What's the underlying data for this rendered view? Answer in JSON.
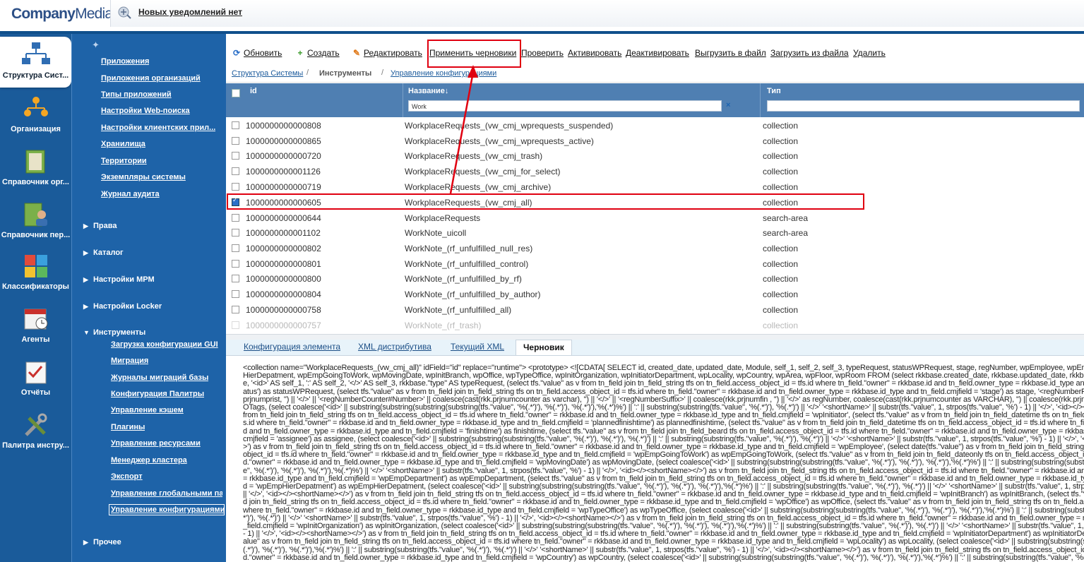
{
  "header": {
    "logo_company": "Company",
    "logo_media": "Media",
    "notification": "Новых уведомлений нет"
  },
  "leftnav": [
    {
      "label": "Структура Сист...",
      "icon": "structure-icon",
      "active": true
    },
    {
      "label": "Организация",
      "icon": "org-chart-icon"
    },
    {
      "label": "Справочник орг...",
      "icon": "folder-icon"
    },
    {
      "label": "Справочник пер...",
      "icon": "people-folder-icon"
    },
    {
      "label": "Классификаторы",
      "icon": "puzzle-icon"
    },
    {
      "label": "Агенты",
      "icon": "calendar-icon"
    },
    {
      "label": "Отчёты",
      "icon": "report-icon"
    },
    {
      "label": "Палитра инстру...",
      "icon": "tools-icon"
    }
  ],
  "tree": {
    "links": [
      "Приложения",
      "Приложения организаций",
      "Типы приложений",
      "Настройки Web-поиска",
      "Настройки клиентских прил...",
      "Хранилища",
      "Территории",
      "Экземпляры системы",
      "Журнал аудита"
    ],
    "groups": [
      "Права",
      "Каталог",
      "Настройки МРМ",
      "Настройки Locker"
    ],
    "tools_group": "Инструменты",
    "tools_items": [
      "Загрузка конфигурации GUI",
      "Миграция",
      "Журналы миграций базы",
      "Конфигурация Палитры",
      "Управление кэшем",
      "Плагины",
      "Управление ресурсами",
      "Менеджер кластера",
      "Экспорт",
      "Управление глобальными па",
      "Управление конфигурациями"
    ],
    "other_group": "Прочее"
  },
  "toolbar": {
    "refresh": "Обновить",
    "create": "Создать",
    "edit": "Редактировать",
    "apply_drafts": "Применить черновики",
    "check": "Проверить",
    "activate": "Активировать",
    "deactivate": "Деактивировать",
    "export": "Выгрузить в файл",
    "import": "Загрузить из файла",
    "delete": "Удалить"
  },
  "breadcrumb": {
    "root": "Структура Системы",
    "middle": "Инструменты",
    "current": "Управление конфигурациями"
  },
  "grid": {
    "col_id": "id",
    "col_name": "Название↓",
    "col_type": "Тип",
    "filter_name": "Work",
    "filter_type": "",
    "rows": [
      {
        "id": "1000000000000808",
        "name": "WorkplaceRequests_(vw_cmj_wprequests_suspended)",
        "type": "collection",
        "checked": false
      },
      {
        "id": "1000000000000865",
        "name": "WorkplaceRequests_(vw_cmj_wprequests_active)",
        "type": "collection",
        "checked": false
      },
      {
        "id": "1000000000000720",
        "name": "WorkplaceRequests_(vw_cmj_trash)",
        "type": "collection",
        "checked": false
      },
      {
        "id": "1000000000001126",
        "name": "WorkplaceRequests_(vw_cmj_for_select)",
        "type": "collection",
        "checked": false
      },
      {
        "id": "1000000000000719",
        "name": "WorkplaceRequests_(vw_cmj_archive)",
        "type": "collection",
        "checked": false
      },
      {
        "id": "1000000000000605",
        "name": "WorkplaceRequests_(vw_cmj_all)",
        "type": "collection",
        "checked": true
      },
      {
        "id": "1000000000000644",
        "name": "WorkplaceRequests",
        "type": "search-area",
        "checked": false
      },
      {
        "id": "1000000000001102",
        "name": "WorkNote_uicoll",
        "type": "search-area",
        "checked": false
      },
      {
        "id": "1000000000000802",
        "name": "WorkNote_(rf_unfulfilled_null_res)",
        "type": "collection",
        "checked": false
      },
      {
        "id": "1000000000000801",
        "name": "WorkNote_(rf_unfulfilled_control)",
        "type": "collection",
        "checked": false
      },
      {
        "id": "1000000000000800",
        "name": "WorkNote_(rf_unfulfilled_by_rf)",
        "type": "collection",
        "checked": false
      },
      {
        "id": "1000000000000804",
        "name": "WorkNote_(rf_unfulfilled_by_author)",
        "type": "collection",
        "checked": false
      },
      {
        "id": "1000000000000758",
        "name": "WorkNote_(rf_unfulfilled_all)",
        "type": "collection",
        "checked": false
      },
      {
        "id": "1000000000000757",
        "name": "WorkNote_(rf_trash)",
        "type": "collection",
        "checked": false
      }
    ]
  },
  "tabs": [
    "Конфигурация элемента",
    "XML дистрибутива",
    "Текущий XML",
    "Черновик"
  ],
  "active_tab": "Черновик",
  "xml_content": "<collection name=\"WorkplaceRequests_(vw_cmj_all)\" idField=\"id\" replace=\"runtime\"> <prototype> <![CDATA[ SELECT id, created_date, updated_date, Module, self_1, self_2, self_3, typeRequest, statusWPRequest, stage, regNumber, wpEmployee, wpEmpDepartment, wpEmpHierDepatment, wpEmpGoingToWork, wpMovingDate, wpInitBranch, wpOffice, wpTypeOffice, wpInitOrganization, wpInitiatorDepartment, wpLocality, wpCountry, wpArea, wpFloor, wpRoom FROM (select rkkbase.created_date, rkkbase.updated_date, rkkbase.module AS Module, '<id>' AS self_1, ':' AS self_2, '</>' AS self_3, rkkbase.\"type\" AS typeRequest, (select tfs.\"value\" as v from tn_field join tn_field_string tfs on tn_field.access_object_id = tfs.id where tn_field.\"owner\" = rkkbase.id and tn_field.owner_type = rkkbase.id_type and tn_field.cmjfield = 'status') as statusWPRequest, (select tfs.\"value\" as v from tn_field join tn_field_string tfs on tn_field.access_object_id = tfs.id where tn_field.\"owner\" = rkkbase.id and tn_field.owner_type = rkkbase.id_type and tn_field.cmjfield = 'stage') as stage, '<regNumberPrefix>' || coalesce(rkk.prjnumprist, '') || '</>' || '<regNumberCounter#Number>' || coalesce(cast(rkk.prjnumcounter as varchar), '') || '</>' || '<regNumberSuffix>' || coalesce(rkk.prjnumfin , '') || '</>' as regNumber, coalesce(cast(rkk.prjnumcounter as VARCHAR), '') || coalesce(rkk.prjnumfin, '') as numberWOTags, (select coalesce('<id>' || substring(substring(substring(substring(tfs.\"value\", '%(.*')'), '%(.*')'), '%(.*')'),'%(.*')%') || ':' || substring(substring(tfs.\"value\", '%(.*')'), '%(.*')') || '</>' '<shortName>' || substr(tfs.\"value\", 1, strpos(tfs.\"value\", '%') - 1) || '</>', '<id></><shortName></>') as v from tn_field join tn_field_string tfs on tn_field.access_object_id = tfs.id where tn_field.\"owner\" = rkkbase.id and tn_field.owner_type = rkkbase.id_type and tn_field.cmjfield = 'wpInitiator', (select tfs.\"value\" as v from tn_field join tn_field_datetime tfs on tn_field.access_object_id = tfs.id where tn_field.\"owner\" = rkkbase.id and tn_field.owner_type = rkkbase.id_type and tn_field.cmjfield = 'plannedfinishtime') as plannedfinishtime, (select tfs.\"value\" as v from tn_field join tn_field_datetime tfs on tn_field.access_object_id = tfs.id where tn_field.\"owner\" = rkkbase.id and tn_field.owner_type = rkkbase.id_type and tn_field.cmjfield = 'finishtime') as finishtime, (select tfs.\"value\" as v from tn_field join tn_field_beard tfs on tn_field.access_object_id = tfs.id where tn_field.\"owner\" = rkkbase.id and tn_field.owner_type = rkkbase.id_type and tn_field.cmjfield = 'assignee') as assignee, (select coalesce('<id>' || substring(substring(substring(tfs.\"value\", '%(.*')'), '%(.*')'), '%(.*')') || ':' || substring(substring(tfs.\"value\", '%(.*')'), '%(.*')') || '</>' '<shortName>' || substr(tfs.\"value\", 1, strpos(tfs.\"value\", '%') - 1) || '</>', '<id></><shortName></>') as v from tn_field join tn_field_string tfs on tn_field.access_object_id = tfs.id where tn_field.\"owner\" = rkkbase.id and tn_field.owner_type = rkkbase.id_type and tn_field.cmjfield = 'wpEmployee', (select date(tfs.\"value\") as v from tn_field join tn_field_string tfs on tn_field.access_object_id = tfs.id where tn_field.\"owner\" = rkkbase.id and tn_field.owner_type = rkkbase.id_type and tn_field.cmjfield = 'wpEmpGoingToWork') as wpEmpGoingToWork, (select tfs.\"value\" as v from tn_field join tn_field_dateonly tfs on tn_field.access_object_id = tfs.id where tn_field.\"owner\" = rkkbase.id and tn_field.owner_type = rkkbase.id_type and tn_field.cmjfield = 'wpMovingDate') as wpMovingDate, (select coalesce('<id>' || substring(substring(substring(tfs.\"value\", '%(.*')'), '%(.*')'), '%(.*')'),'%(.*')%') || ':' || substring(substring(substring(substring(tfs.\"value\", '%(.*')'), '%(.*')'), '%(.*')'),'%(.*')%') || '</>' '<shortName>' || substr(tfs.\"value\", 1, strpos(tfs.\"value\", '%') - 1) || '</>', '<id></><shortName></>') as v from tn_field join tn_field_string tfs on tn_field.access_object_id = tfs.id where tn_field.\"owner\" = rkkbase.id and tn_field.owner_type = rkkbase.id_type and tn_field.cmjfield = 'wpEmpDepartment') as wpEmpDepartment, (select tfs.\"value\" as v from tn_field join tn_field_string tfs on tn_field.access_object_id = tfs.id where tn_field.\"owner\" = rkkbase.id and tn_field.owner_type = rkkbase.id_type and tn_field.cmjfield = 'wpEmpHierDepatment') as wpEmpHierDepatment, (select coalesce('<id>' || substring(substring(substring(tfs.\"value\", '%(.*')'), '%(.*')'), '%(.*')'),'%(.*')%') || ':' || substring(substring(tfs.\"value\", '%(.*')'), '%(.*')') || '</>' '<shortName>' || substr(tfs.\"value\", 1, strpos(tfs.\"value\", '%') - 1) || '</>', '<id></><shortName></>') as v from tn_field join tn_field_string tfs on tn_field.access_object_id = tfs.id where tn_field.\"owner\" = rkkbase.id and tn_field.owner_type = rkkbase.id_type and tn_field.cmjfield = 'wpInitBranch') as wpInitBranch, (select tfs.\"value\" as v from tn_field join tn_field_string tfs on tn_field.access_object_id = tfs.id where tn_field.\"owner\" = rkkbase.id and tn_field.owner_type = rkkbase.id_type and tn_field.cmjfield = 'wpOffice') as wpOffice, (select tfs.\"value\" as v from tn_field join tn_field_string tfs on tn_field.access_object_id = tfs.id where tn_field.\"owner\" = rkkbase.id and tn_field.owner_type = rkkbase.id_type and tn_field.cmjfield = 'wpTypeOffice') as wpTypeOffice, (select coalesce('<id>' || substring(substring(substring(tfs.\"value\", '%(.*')'), '%(.*')'), '%(.*')'),'%(.*')%') || ':' || substring(substring(tfs.\"value\", '%(.*')'), '%(.*')') || '</>' '<shortName>' || substr(tfs.\"value\", 1, strpos(tfs.\"value\", '%') - 1) || '</>', '<id></><shortName></>') as v from tn_field join tn_field_string tfs on tn_field.access_object_id = tfs.id where tn_field.\"owner\" = rkkbase.id and tn_field.owner_type = rkkbase.id_type and tn_field.cmjfield = 'wpInitOrganization') as wpInitOrganization, (select coalesce('<id>' || substring(substring(substring(tfs.\"value\", '%(.*')'), '%(.*')'), '%(.*')'),'%(.*')%') || ':' || substring(substring(tfs.\"value\", '%(.*')'), '%(.*')') || '</>' '<shortName>' || substr(tfs.\"value\", 1, strpos(tfs.\"value\", '%') - 1) || '</>', '<id></><shortName></>') as v from tn_field join tn_field_string tfs on tn_field.access_object_id = tfs.id where tn_field.\"owner\" = rkkbase.id and tn_field.owner_type = rkkbase.id_type and tn_field.cmjfield = 'wpInitiatorDepartment') as wpInitiatorDepartment, (select tfs.\"value\" as v from tn_field join tn_field_string tfs on tn_field.access_object_id = tfs.id where tn_field.\"owner\" = rkkbase.id and tn_field.owner_type = rkkbase.id_type and tn_field.cmjfield = 'wpLocality') as wpLocality, (select coalesce('<id>' || substring(substring(substring(tfs.\"value\", '%(.*')'), '%(.*')'), '%(.*')'),'%(.*')%') || ':' || substring(substring(tfs.\"value\", '%(.*')'), '%(.*')') || '</>' '<shortName>' || substr(tfs.\"value\", 1, strpos(tfs.\"value\", '%') - 1) || '</>', '<id></><shortName></>') as v from tn_field join tn_field_string tfs on tn_field.access_object_id = tfs.id where tn_field.\"owner\" = rkkbase.id and tn_field.owner_type = rkkbase.id_type and tn_field.cmjfield = 'wpCountry') as wpCountry, (select coalesce('<id>' || substring(substring(substring(tfs.\"value\", '%(.*')'), '%(.*')'), '%(.*')'),'%(.*')%') || ':' || substring(substring(tfs.\"value\", '%(.*')'), '%(.*')') || '</>' '<shortName>' || substr(tfs.\"value\", 1, strpos(tfs.\"value\", '%') - 1) || '</>', '<id></><shortName></>') as v from tn_field join tn_field_string tfs on tn_field.access_object_id = tfs.id where tn_field.\"owner\" = rkkbase.id and tn_field.owner_type = rkkbase.id_type and tn_field.cmjfield = 'wpArea') as wpArea",
  "colors": {
    "accent": "#1e63a8",
    "nav": "#1a5b9a",
    "grid_header": "#4f7fb2",
    "annotation": "#e00010"
  }
}
